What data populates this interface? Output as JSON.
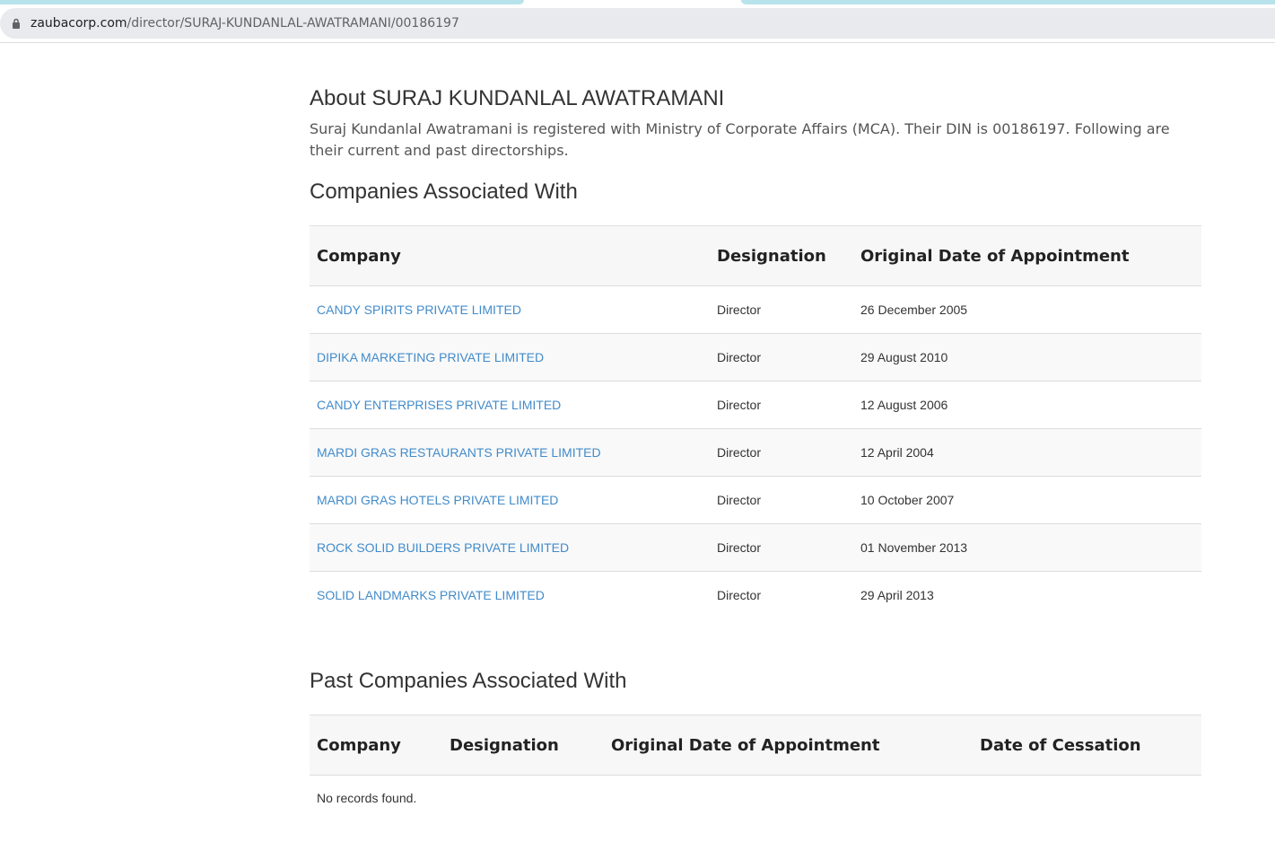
{
  "browser": {
    "url_host": "zaubacorp.com",
    "url_path": "/director/SURAJ-KUNDANLAL-AWATRAMANI/00186197",
    "lock_icon": "lock-icon"
  },
  "about": {
    "title": "About SURAJ KUNDANLAL AWATRAMANI",
    "description": "Suraj Kundanlal Awatramani is registered with Ministry of Corporate Affairs (MCA). Their DIN is 00186197. Following are their current and past directorships."
  },
  "current": {
    "heading": "Companies Associated With",
    "columns": [
      "Company",
      "Designation",
      "Original Date of Appointment"
    ],
    "rows": [
      {
        "company": "CANDY SPIRITS PRIVATE LIMITED",
        "designation": "Director",
        "date": "26 December 2005"
      },
      {
        "company": "DIPIKA MARKETING PRIVATE LIMITED",
        "designation": "Director",
        "date": "29 August 2010"
      },
      {
        "company": "CANDY ENTERPRISES PRIVATE LIMITED",
        "designation": "Director",
        "date": "12 August 2006"
      },
      {
        "company": "MARDI GRAS RESTAURANTS PRIVATE LIMITED",
        "designation": "Director",
        "date": "12 April 2004"
      },
      {
        "company": "MARDI GRAS HOTELS PRIVATE LIMITED",
        "designation": "Director",
        "date": "10 October 2007"
      },
      {
        "company": "ROCK SOLID BUILDERS PRIVATE LIMITED",
        "designation": "Director",
        "date": "01 November 2013"
      },
      {
        "company": "SOLID LANDMARKS PRIVATE LIMITED",
        "designation": "Director",
        "date": "29 April 2013"
      }
    ]
  },
  "past": {
    "heading": "Past Companies Associated With",
    "columns": [
      "Company",
      "Designation",
      "Original Date of Appointment",
      "Date of Cessation"
    ],
    "empty_text": "No records found."
  },
  "colors": {
    "link": "#428bca",
    "tab_accent": "#b9e3ec"
  }
}
